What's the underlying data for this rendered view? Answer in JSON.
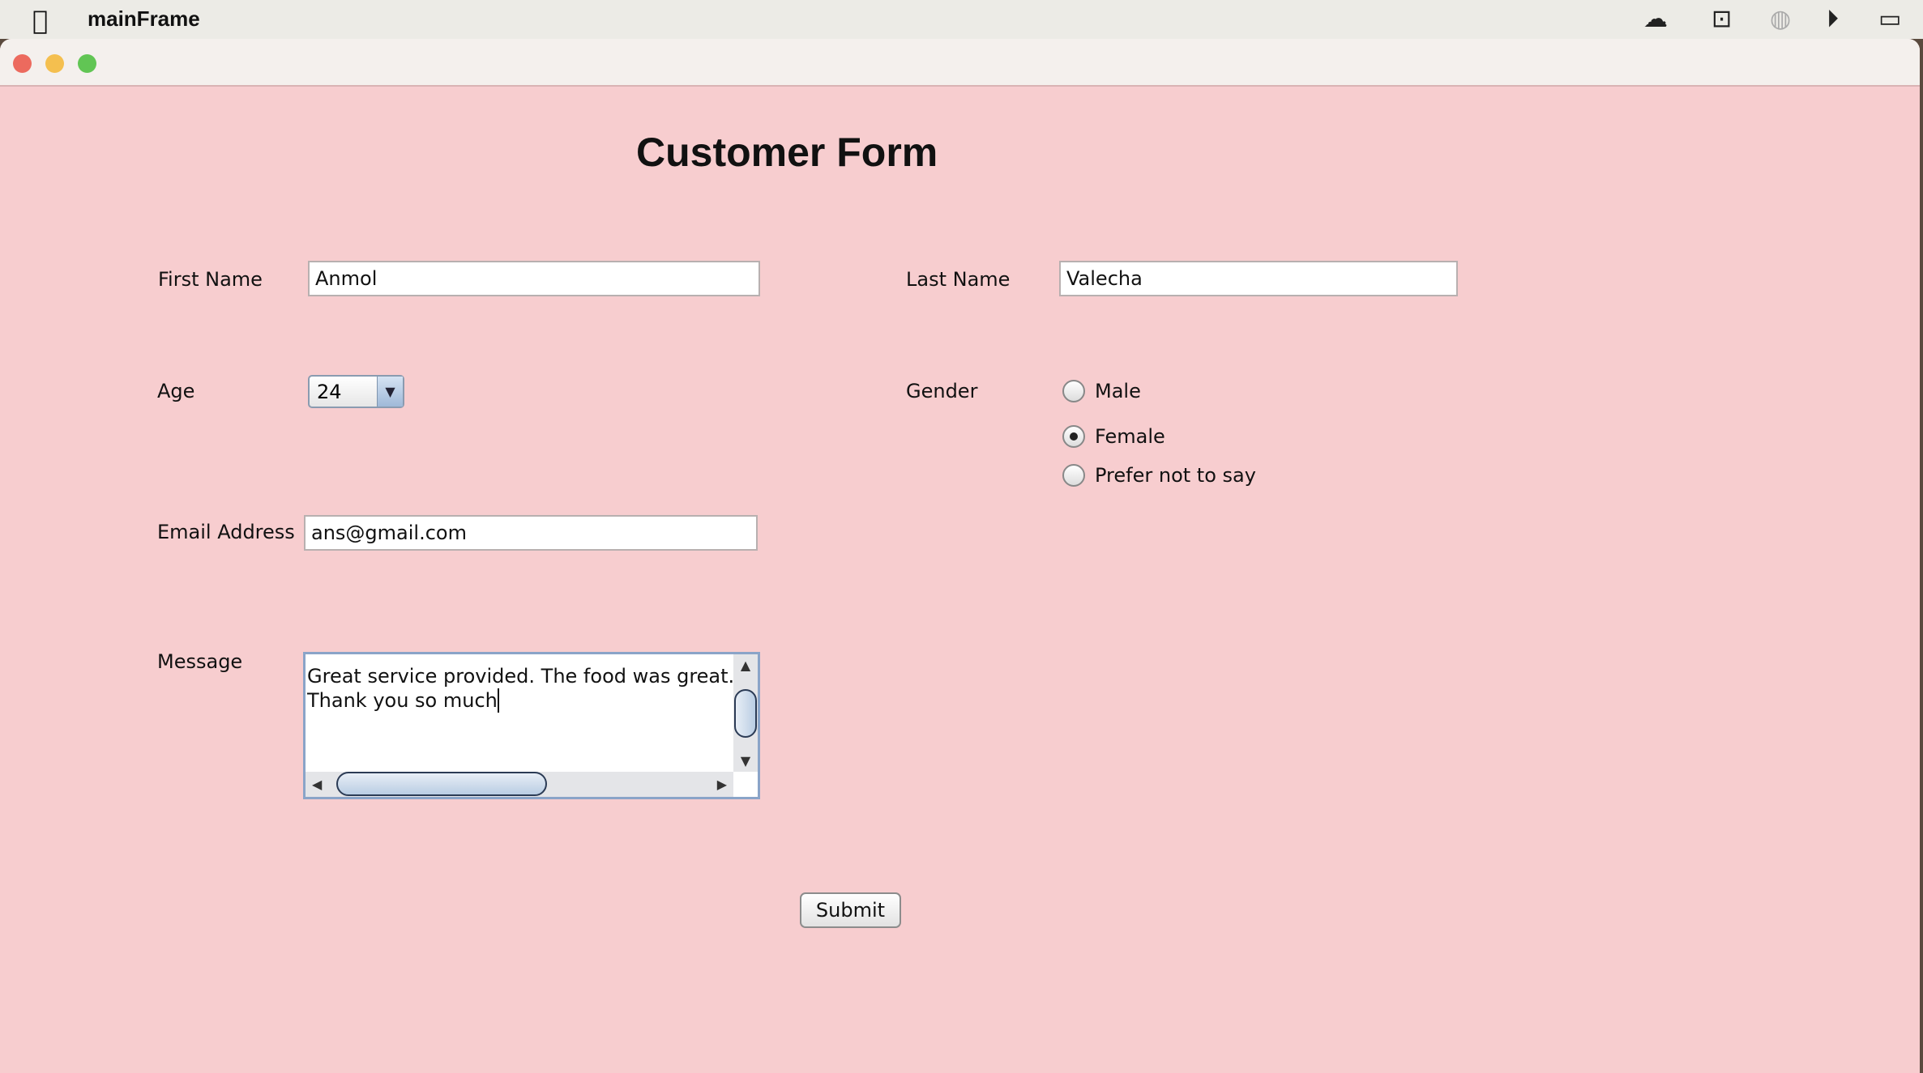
{
  "menubar": {
    "app_name": "mainFrame"
  },
  "form": {
    "title": "Customer Form",
    "first_name": {
      "label": "First Name",
      "value": "Anmol"
    },
    "last_name": {
      "label": "Last Name",
      "value": "Valecha"
    },
    "age": {
      "label": "Age",
      "value": "24"
    },
    "gender": {
      "label": "Gender",
      "options": [
        {
          "label": "Male",
          "selected": false
        },
        {
          "label": "Female",
          "selected": true
        },
        {
          "label": "Prefer not to say",
          "selected": false
        }
      ]
    },
    "email": {
      "label": "Email Address",
      "value": "ans@gmail.com"
    },
    "message": {
      "label": "Message",
      "line1": "Great service provided. The food was great. I",
      "line2": "Thank you so much"
    },
    "submit_label": "Submit"
  },
  "colors": {
    "background": "#f7cdcf"
  }
}
